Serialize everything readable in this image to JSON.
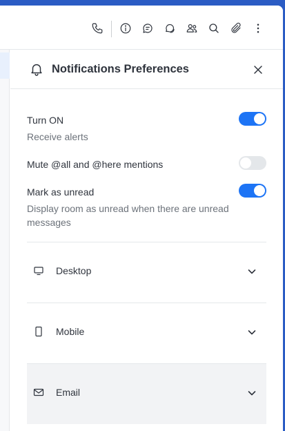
{
  "topbar": {
    "icons": [
      "phone-icon",
      "info-icon",
      "threads-icon",
      "discussion-icon",
      "members-icon",
      "search-icon",
      "attachment-icon",
      "kebab-menu-icon"
    ]
  },
  "panel": {
    "title": "Notifications Preferences",
    "turn_on": {
      "label": "Turn ON",
      "hint": "Receive alerts",
      "enabled": true
    },
    "mute_mentions": {
      "label": "Mute @all and @here mentions",
      "enabled": false
    },
    "mark_unread": {
      "label": "Mark as unread",
      "hint": "Display room as unread when there are unread messages",
      "enabled": true
    },
    "sections": [
      {
        "label": "Desktop",
        "icon": "desktop-icon"
      },
      {
        "label": "Mobile",
        "icon": "mobile-icon"
      },
      {
        "label": "Email",
        "icon": "email-icon"
      }
    ]
  },
  "colors": {
    "accent": "#1d74f5",
    "toggle_off": "#e4e7ea",
    "text": "#2f343d",
    "hint": "#6c727a"
  }
}
